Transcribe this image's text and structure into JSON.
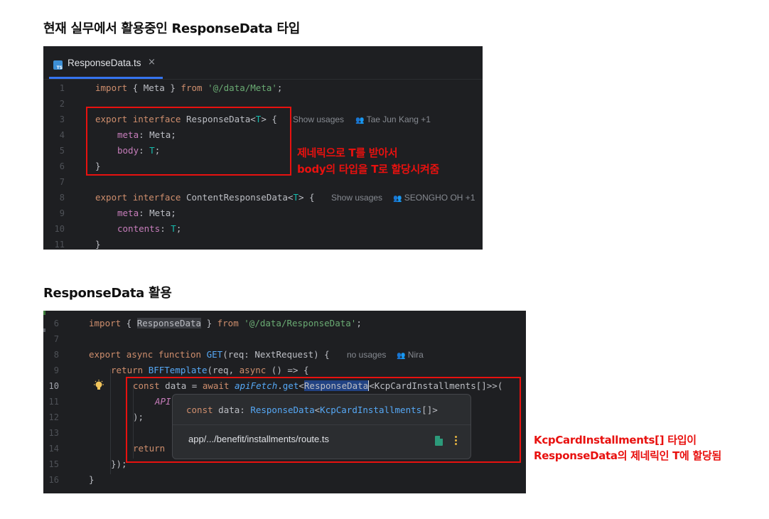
{
  "section1": {
    "heading": "현재 실무에서 활용중인 ResponseData 타입",
    "tab": {
      "filename": "ResponseData.ts",
      "close": "×",
      "icon": "TS"
    },
    "lines": [
      "1",
      "2",
      "3",
      "4",
      "5",
      "6",
      "7",
      "8",
      "9",
      "10",
      "11"
    ],
    "code": {
      "l1_import": "import",
      "l1_mid": " { Meta } ",
      "l1_from": "from",
      "l1_path": "'@/data/Meta'",
      "l1_end": ";",
      "l3_export": "export",
      "l3_interface": "interface",
      "l3_name": " ResponseData<",
      "l3_t": "T",
      "l3_end": "> {",
      "l4_prop": "meta",
      "l4_rest": ": Meta;",
      "l5_prop": "body",
      "l5_colon": ": ",
      "l5_t": "T",
      "l5_end": ";",
      "l6": "}",
      "l8_export": "export",
      "l8_interface": "interface",
      "l8_name": " ContentResponseData<",
      "l8_t": "T",
      "l8_end": "> {",
      "l9_prop": "meta",
      "l9_rest": ": Meta;",
      "l10_prop": "contents",
      "l10_colon": ": ",
      "l10_t": "T",
      "l10_end": ";",
      "l11": "}"
    },
    "hints": {
      "usages1": "Show usages",
      "author1": "Tae Jun Kang +1",
      "usages2": "Show usages",
      "author2": "SEONGHO OH +1"
    },
    "annotation": [
      "제네릭으로 T를 받아서",
      "body의 타입을 T로 할당시켜줌"
    ]
  },
  "section2": {
    "heading": "ResponseData 활용",
    "lines": [
      "6",
      "7",
      "8",
      "9",
      "10",
      "11",
      "12",
      "13",
      "14",
      "15",
      "16"
    ],
    "code": {
      "l6_import": "import",
      "l6_open": " { ",
      "l6_name": "ResponseData",
      "l6_close": " } ",
      "l6_from": "from",
      "l6_path": "'@/data/ResponseData'",
      "l6_end": ";",
      "l8_export": "export",
      "l8_async": "async",
      "l8_function": "function",
      "l8_get": "GET",
      "l8_rest": "(req: NextRequest) {",
      "l9_return": "return",
      "l9_fn": "BFFTemplate",
      "l9_mid": "(req, ",
      "l9_async": "async",
      "l9_end": " () => {",
      "l10_const": "const",
      "l10_data": " data = ",
      "l10_await": "await",
      "l10_fn": "apiFetch",
      "l10_dot": ".",
      "l10_get": "get",
      "l10_lt": "<",
      "l10_sel": "ResponseData",
      "l10_rest": "<KcpCardInstallments[]>>(",
      "l11": "API",
      "l12": ");",
      "l14_return": "return",
      "l15": "});",
      "l16": "}"
    },
    "hints": {
      "usages": "no usages",
      "author": "Nira"
    },
    "popup": {
      "const": "const",
      "data": " data: ",
      "type": "ResponseData",
      "lt": "<",
      "inner": "KcpCardInstallments",
      "end": "[]>",
      "path": "app/.../benefit/installments/route.ts"
    },
    "annotation": [
      "KcpCardInstallments[] 타입이",
      "ResponseData의 제네릭인 T에 할당됨"
    ]
  },
  "colors": {
    "keyword": "#cf8e6d",
    "string": "#6aab73",
    "property": "#c77dbb",
    "typeParam": "#16baac",
    "function": "#56a8f5",
    "annotation": "#e8110f",
    "editorBg": "#1e1f22"
  }
}
